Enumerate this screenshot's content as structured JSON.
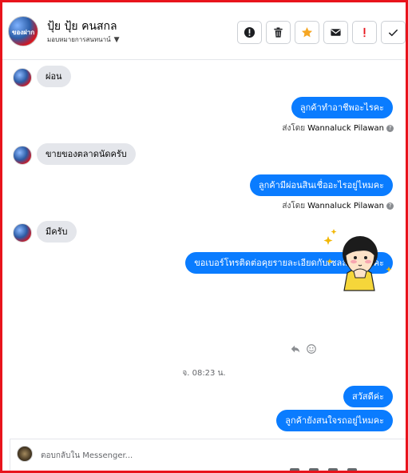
{
  "header": {
    "contact_name": "ปุ้ย ปุ้ย คนสกล",
    "assigned_to": "มอบหมายการสนทนาน์",
    "avatar_text": "ของฝาก",
    "tools": [
      {
        "icon": "alert-circle-icon"
      },
      {
        "icon": "trash-icon"
      },
      {
        "icon": "star-icon",
        "color": "#f5a623"
      },
      {
        "icon": "envelope-icon"
      },
      {
        "icon": "exclamation-icon",
        "color": "#e8141c"
      },
      {
        "icon": "check-icon"
      }
    ]
  },
  "messages": [
    {
      "side": "in",
      "text": "ผ่อน"
    },
    {
      "side": "out",
      "text": "ลูกค้าทำอาชีพอะไรคะ",
      "sent_by_prefix": "ส่งโดย",
      "sent_by": "Wannaluck Pilawan"
    },
    {
      "side": "in",
      "text": "ขายของตลาดนัดครับ"
    },
    {
      "side": "out",
      "text": "ลูกค้ามีผ่อนสินเชื่ออะไรอยู่ไหมคะ",
      "sent_by_prefix": "ส่งโดย",
      "sent_by": "Wannaluck Pilawan"
    },
    {
      "side": "in",
      "text": "มีครับ"
    },
    {
      "side": "out",
      "text": "ขอเบอร์โทรติดต่อคุยรายละเอียดกับเซลล์ได้ไหมคะ"
    },
    {
      "side": "out",
      "type": "sticker",
      "sticker": "girl-hands-clasped-sparkles"
    },
    {
      "type": "timestamp",
      "text": "จ. 08:23 น."
    },
    {
      "side": "out",
      "text": "สวัสดีค่ะ"
    },
    {
      "side": "out",
      "text": "ลูกค้ายังสนใจรถอยู่ไหมคะ"
    }
  ],
  "composer": {
    "placeholder": "ตอบกลับใน Messenger..."
  },
  "colors": {
    "frame_border": "#e8141c",
    "outgoing_bubble": "#0a7cff",
    "incoming_bubble": "#e4e6eb"
  }
}
